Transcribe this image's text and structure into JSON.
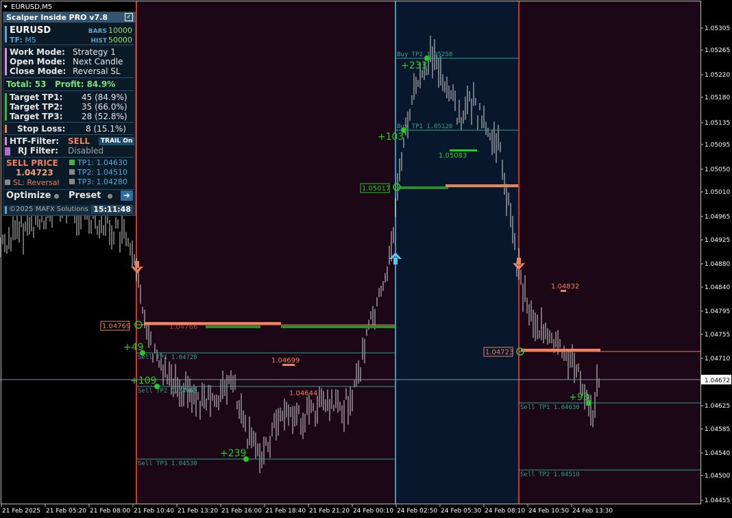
{
  "window": {
    "title": "EURUSD,M5"
  },
  "panel": {
    "title": "Scalper Inside PRO v7.8",
    "symbol": "EURUSD",
    "tf_label": "TF:",
    "tf": "M5",
    "bars_label": "BARS",
    "bars": "10000",
    "hist_label": "HIST",
    "hist": "50000",
    "work_mode_label": "Work  Mode:",
    "work_mode": "Strategy 1",
    "open_mode_label": "Open  Mode:",
    "open_mode": "Next Candle",
    "close_mode_label": "Close Mode:",
    "close_mode": "Reversal SL",
    "total": "Total: 53",
    "profit": "Profit: 84.9%",
    "tp1_label": "Target TP1:",
    "tp1": "45 (84.9%)",
    "tp2_label": "Target TP2:",
    "tp2": "35 (66.0%)",
    "tp3_label": "Target TP3:",
    "tp3": "28 (52.8%)",
    "sl_label": "Stop Loss:",
    "sl": "8 (15.1%)",
    "htf_label": "HTF-Filter:",
    "htf": "SELL",
    "trail": "TRAIL On",
    "rj_label": "RJ Filter:",
    "rj": "Disabled",
    "sell_price_label": "SELL PRICE",
    "sell_price": "1.04723",
    "sl_mode": "SL: Reversal",
    "tp1_price": "TP1: 1.04630",
    "tp2_price": "TP2: 1.04510",
    "tp3_price": "TP3: 1.04280",
    "optimize": "Optimize",
    "preset": "Preset",
    "copyright": "©2025 MAFX Solutions",
    "time": "15:11:48"
  },
  "price_axis": {
    "labels": [
      "1.05305",
      "1.05265",
      "1.05220",
      "1.05180",
      "1.05135",
      "1.05095",
      "1.05050",
      "1.05010",
      "1.04965",
      "1.04925",
      "1.04880",
      "1.04840",
      "1.04795",
      "1.04755",
      "1.04710",
      "1.04672",
      "1.04625",
      "1.04585",
      "1.04540",
      "1.04500",
      "1.04455"
    ],
    "current": "1.04672"
  },
  "time_axis": {
    "labels": [
      "21 Feb 2025",
      "21 Feb 05:20",
      "21 Feb 08:00",
      "21 Feb 10:40",
      "21 Feb 13:20",
      "21 Feb 16:00",
      "21 Feb 18:40",
      "21 Feb 21:20",
      "24 Feb 00:10",
      "24 Feb 02:50",
      "24 Feb 05:30",
      "24 Feb 08:10",
      "24 Feb 10:50",
      "24 Feb 13:30"
    ]
  },
  "annotations": {
    "sell1_entry": "1.04769",
    "sell1_tp1": "Sell TP1 1.04720",
    "sell1_tp2": "Sell TP2 1.04660",
    "sell1_tp3": "Sell TP3 1.04530",
    "sell1_p49": "+49",
    "sell1_p109": "+109",
    "sell1_p239": "+239",
    "sell1_mid": "1.04699",
    "sell1_low": "1.04644",
    "sell1_hint": "1.04766",
    "buy_entry": "1.05017",
    "buy_tp1": "Buy TP1 1.05120",
    "buy_tp2": "Buy TP2 1.05250",
    "buy_p103": "+103",
    "buy_p233": "+233",
    "buy_mid": "1.05083",
    "sell2_entry": "1.04723",
    "sell2_tp1": "Sell TP1 1.04630",
    "sell2_tp2": "Sell TP2 1.04510",
    "sell2_p93": "+93",
    "sell2_high": "1.04832"
  },
  "colors": {
    "sell_zone": "#1b0716",
    "buy_zone": "#08172b",
    "sell_line": "#c8382e",
    "buy_line": "#2e9ec4",
    "tp_line": "#2fa38f",
    "green": "#22cc22",
    "salmon": "#f08060"
  }
}
